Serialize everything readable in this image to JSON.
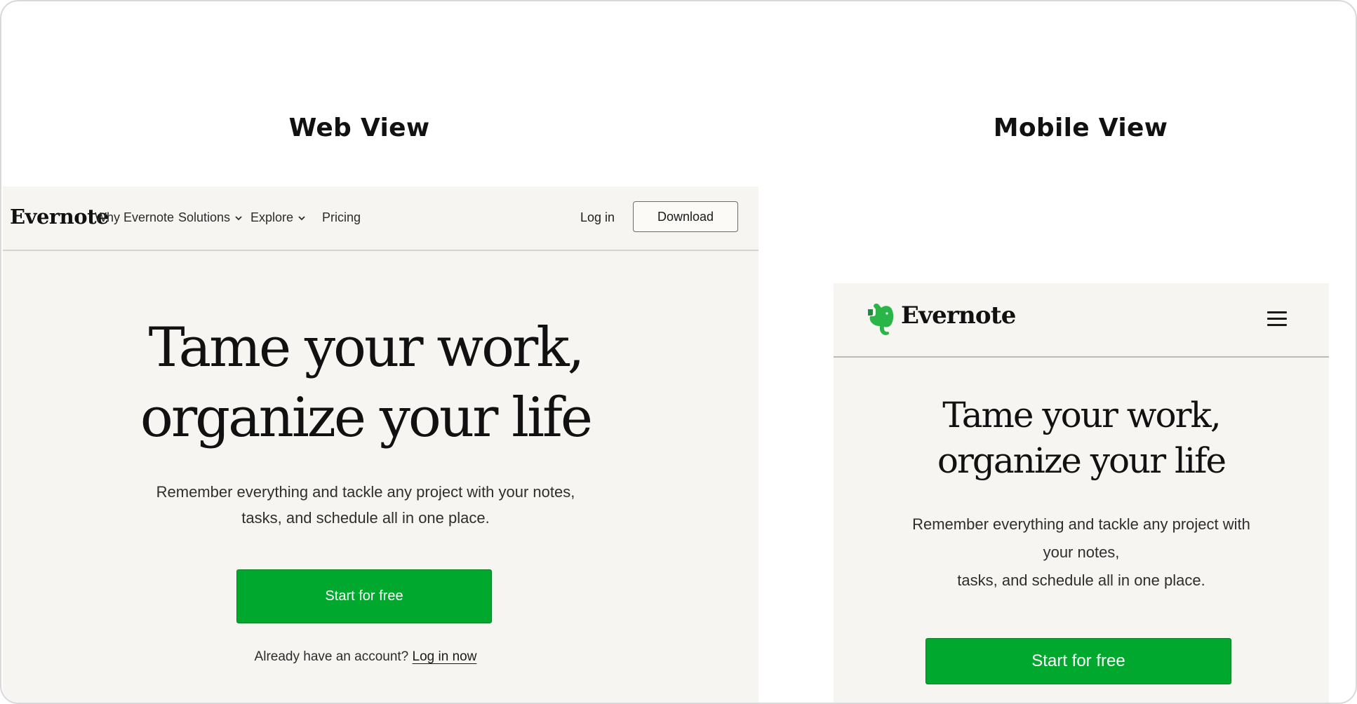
{
  "labels": {
    "web_view": "Web View",
    "mobile_view": "Mobile View"
  },
  "web": {
    "logo": "Evernote",
    "nav": {
      "why": "Why Evernote",
      "solutions": "Solutions",
      "explore": "Explore",
      "pricing": "Pricing"
    },
    "login": "Log in",
    "download": "Download",
    "hero": {
      "line1": "Tame your work,",
      "line2": "organize your life",
      "sub_line1": "Remember everything and tackle any project with your notes,",
      "sub_line2": "tasks, and schedule all in one place.",
      "cta": "Start for free",
      "account_prompt": "Already have an account?",
      "account_link": "Log in now"
    }
  },
  "mobile": {
    "logo": "Evernote",
    "menu_icon": "hamburger-menu-icon",
    "hero": {
      "line1": "Tame your work,",
      "line2": "organize your life",
      "sub_line1": "Remember everything and tackle any project with",
      "sub_line2": "your notes,",
      "sub_line3": "tasks, and schedule all in one place.",
      "cta": "Start for free"
    }
  },
  "colors": {
    "brand_green": "#00a82d",
    "background": "#f7f5f1",
    "text": "#111111"
  }
}
